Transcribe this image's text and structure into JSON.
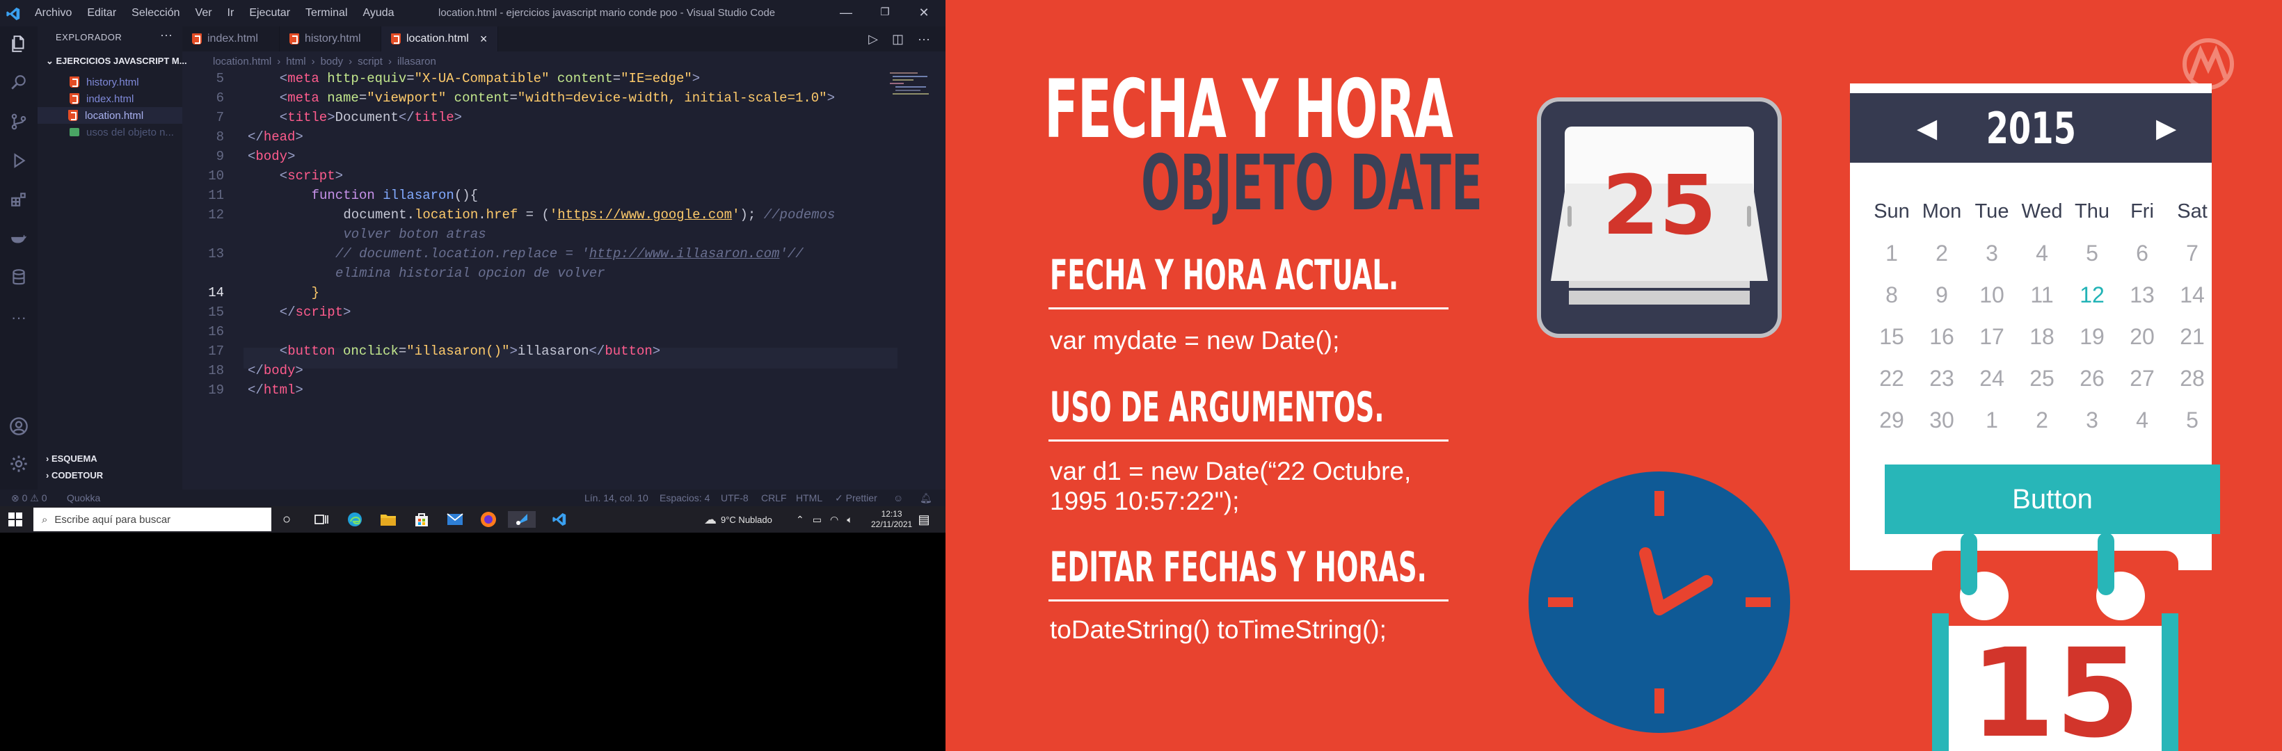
{
  "vscode": {
    "menu": [
      "Archivo",
      "Editar",
      "Selección",
      "Ver",
      "Ir",
      "Ejecutar",
      "Terminal",
      "Ayuda"
    ],
    "window_title": "location.html - ejercicios javascript mario conde poo - Visual Studio Code",
    "tabs": [
      "index.html",
      "history.html",
      "location.html"
    ],
    "active_tab_close": "×",
    "sidebar": {
      "header": "EXPLORADOR",
      "project": "EJERCICIOS JAVASCRIPT M...",
      "files": [
        "history.html",
        "index.html",
        "location.html",
        "usos del objeto n..."
      ],
      "sections": [
        "ESQUEMA",
        "CODETOUR"
      ]
    },
    "breadcrumb": [
      "location.html",
      "html",
      "body",
      "script",
      "illasaron"
    ],
    "code_lines": [
      {
        "n": "5",
        "html": "<span style='color:#9aa0c8'>&lt;</span><span style='color:#ff5c8d'>meta</span> <span style='color:#c3e88d'>http-equiv</span>=<span style='color:#ffcb6b'>\"X-UA-Compatible\"</span> <span style='color:#c3e88d'>content</span>=<span style='color:#ffcb6b'>\"IE=edge\"</span><span style='color:#9aa0c8'>&gt;</span>",
        "indent": 4
      },
      {
        "n": "6",
        "html": "<span style='color:#9aa0c8'>&lt;</span><span style='color:#ff5c8d'>meta</span> <span style='color:#c3e88d'>name</span>=<span style='color:#ffcb6b'>\"viewport\"</span> <span style='color:#c3e88d'>content</span>=<span style='color:#ffcb6b'>\"width=device-width, initial-scale=1.0\"</span><span style='color:#9aa0c8'>&gt;</span>",
        "indent": 4
      },
      {
        "n": "7",
        "html": "<span style='color:#9aa0c8'>&lt;</span><span style='color:#ff5c8d'>title</span><span style='color:#9aa0c8'>&gt;</span>Document<span style='color:#9aa0c8'>&lt;/</span><span style='color:#ff5c8d'>title</span><span style='color:#9aa0c8'>&gt;</span>",
        "indent": 4
      },
      {
        "n": "8",
        "html": "<span style='color:#9aa0c8'>&lt;/</span><span style='color:#ff5c8d'>head</span><span style='color:#9aa0c8'>&gt;</span>",
        "indent": 0
      },
      {
        "n": "9",
        "html": "<span style='color:#9aa0c8'>&lt;</span><span style='color:#ff5c8d'>body</span><span style='color:#9aa0c8'>&gt;</span>",
        "indent": 0
      },
      {
        "n": "10",
        "html": "<span style='color:#9aa0c8'>&lt;</span><span style='color:#ff5c8d'>script</span><span style='color:#9aa0c8'>&gt;</span>",
        "indent": 4
      },
      {
        "n": "11",
        "html": "<span style='color:#c792ea'>function</span> <span style='color:#82aaff'>illasaron</span>(){",
        "indent": 8
      },
      {
        "n": "12",
        "html": "document.<span style='color:#ffcb6b'>location</span>.<span style='color:#ffcb6b'>href</span> = (<span style='color:#ffcb6b'>'<u>https://www.google.com</u>'</span>); <span style='color:#6a7091;font-style:italic'>//podemos</span>",
        "indent": 12
      },
      {
        "n": "",
        "html": "<span style='color:#6a7091;font-style:italic'>volver boton atras</span>",
        "indent": 12
      },
      {
        "n": "13",
        "html": "<span style='color:#6a7091;font-style:italic'>// document.location.replace = '<u>http://www.illasaron.com</u>'//</span>",
        "indent": 11
      },
      {
        "n": "",
        "html": "<span style='color:#6a7091;font-style:italic'>elimina historial opcion de volver</span>",
        "indent": 11
      },
      {
        "n": "14",
        "html": "<span style='color:#ffcb6b'>}</span>",
        "indent": 8
      },
      {
        "n": "15",
        "html": "<span style='color:#9aa0c8'>&lt;/</span><span style='color:#ff5c8d'>script</span><span style='color:#9aa0c8'>&gt;</span>",
        "indent": 4
      },
      {
        "n": "16",
        "html": "",
        "indent": 0
      },
      {
        "n": "17",
        "html": "<span style='color:#9aa0c8'>&lt;</span><span style='color:#ff5c8d'>button</span> <span style='color:#c3e88d'>onclick</span>=<span style='color:#ffcb6b'>\"illasaron()\"</span><span style='color:#9aa0c8'>&gt;</span>illasaron<span style='color:#9aa0c8'>&lt;/</span><span style='color:#ff5c8d'>button</span><span style='color:#9aa0c8'>&gt;</span>",
        "indent": 4
      },
      {
        "n": "18",
        "html": "<span style='color:#9aa0c8'>&lt;/</span><span style='color:#ff5c8d'>body</span><span style='color:#9aa0c8'>&gt;</span>",
        "indent": 0
      },
      {
        "n": "19",
        "html": "<span style='color:#9aa0c8'>&lt;/</span><span style='color:#ff5c8d'>html</span><span style='color:#9aa0c8'>&gt;</span>",
        "indent": 0
      }
    ],
    "status": {
      "left": "⊗ 0 ⚠ 0",
      "quokka": "Quokka",
      "position": "Lín. 14, col. 10",
      "spaces": "Espacios: 4",
      "encoding": "UTF-8",
      "eol": "CRLF",
      "language": "HTML",
      "prettier": "✓ Prettier"
    }
  },
  "taskbar": {
    "search_placeholder": "Escribe aquí para buscar",
    "weather": "9°C  Nublado",
    "time": "12:13",
    "date": "22/11/2021"
  },
  "slide": {
    "title_line1": "FECHA Y HORA",
    "title_line2": "OBJETO DATE",
    "sections": [
      {
        "heading": "FECHA Y HORA ACTUAL.",
        "body": "var mydate = new Date();"
      },
      {
        "heading": "USO DE ARGUMENTOS.",
        "body": "var d1 = new Date(“22 Octubre, 1995 10:57:22\");"
      },
      {
        "heading": "EDITAR FECHAS Y HORAS.",
        "body": "toDateString()  toTimeString();"
      }
    ],
    "flip_day": "25",
    "calendar": {
      "year": "2015",
      "prev": "◀",
      "next": "▶",
      "weekdays": [
        "Sun",
        "Mon",
        "Tue",
        "Wed",
        "Thu",
        "Fri",
        "Sat"
      ],
      "weeks": [
        [
          "1",
          "2",
          "3",
          "4",
          "5",
          "6",
          "7"
        ],
        [
          "8",
          "9",
          "10",
          "11",
          "12",
          "13",
          "14"
        ],
        [
          "15",
          "16",
          "17",
          "18",
          "19",
          "20",
          "21"
        ],
        [
          "22",
          "23",
          "24",
          "25",
          "26",
          "27",
          "28"
        ],
        [
          "29",
          "30",
          "1",
          "2",
          "3",
          "4",
          "5"
        ]
      ],
      "highlight": "12",
      "button": "Button"
    },
    "big_date": "15",
    "colors": {
      "background": "#e8432f",
      "navy": "#363a50",
      "teal": "#28b6b8",
      "clock_blue": "#0f5a96"
    }
  }
}
